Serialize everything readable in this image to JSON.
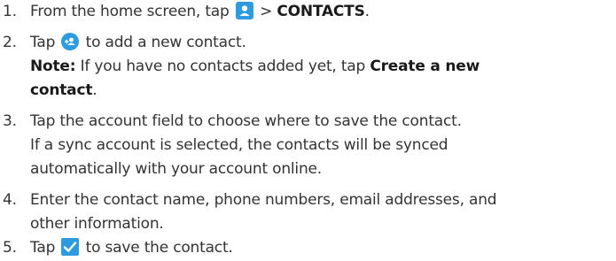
{
  "steps": [
    {
      "number": "1.",
      "before_icon": "From the home screen, tap",
      "icon": "contacts-app-icon",
      "after_icon": "> ",
      "bold": "CONTACTS",
      "end": "."
    },
    {
      "number": "2.",
      "before_icon": "Tap",
      "icon": "add-contact-icon",
      "after_icon": "to add a new contact.",
      "note_label": "Note:",
      "note_text": " If you have no contacts added yet, tap ",
      "note_bold_line1": "Create a new",
      "note_bold_line2": "contact",
      "note_end": "."
    },
    {
      "number": "3.",
      "lines": [
        "Tap the account field to choose where to save the contact.",
        "If a sync account is selected, the contacts will be synced",
        "automatically with your account online."
      ]
    },
    {
      "number": "4.",
      "lines": [
        "Enter the contact name, phone numbers, email addresses, and",
        "other information."
      ]
    },
    {
      "number": "5.",
      "before_icon": "Tap",
      "icon": "checkmark-icon",
      "after_icon": "to save the contact."
    }
  ],
  "colors": {
    "icon_blue": "#2d9be0",
    "text": "#333333"
  }
}
